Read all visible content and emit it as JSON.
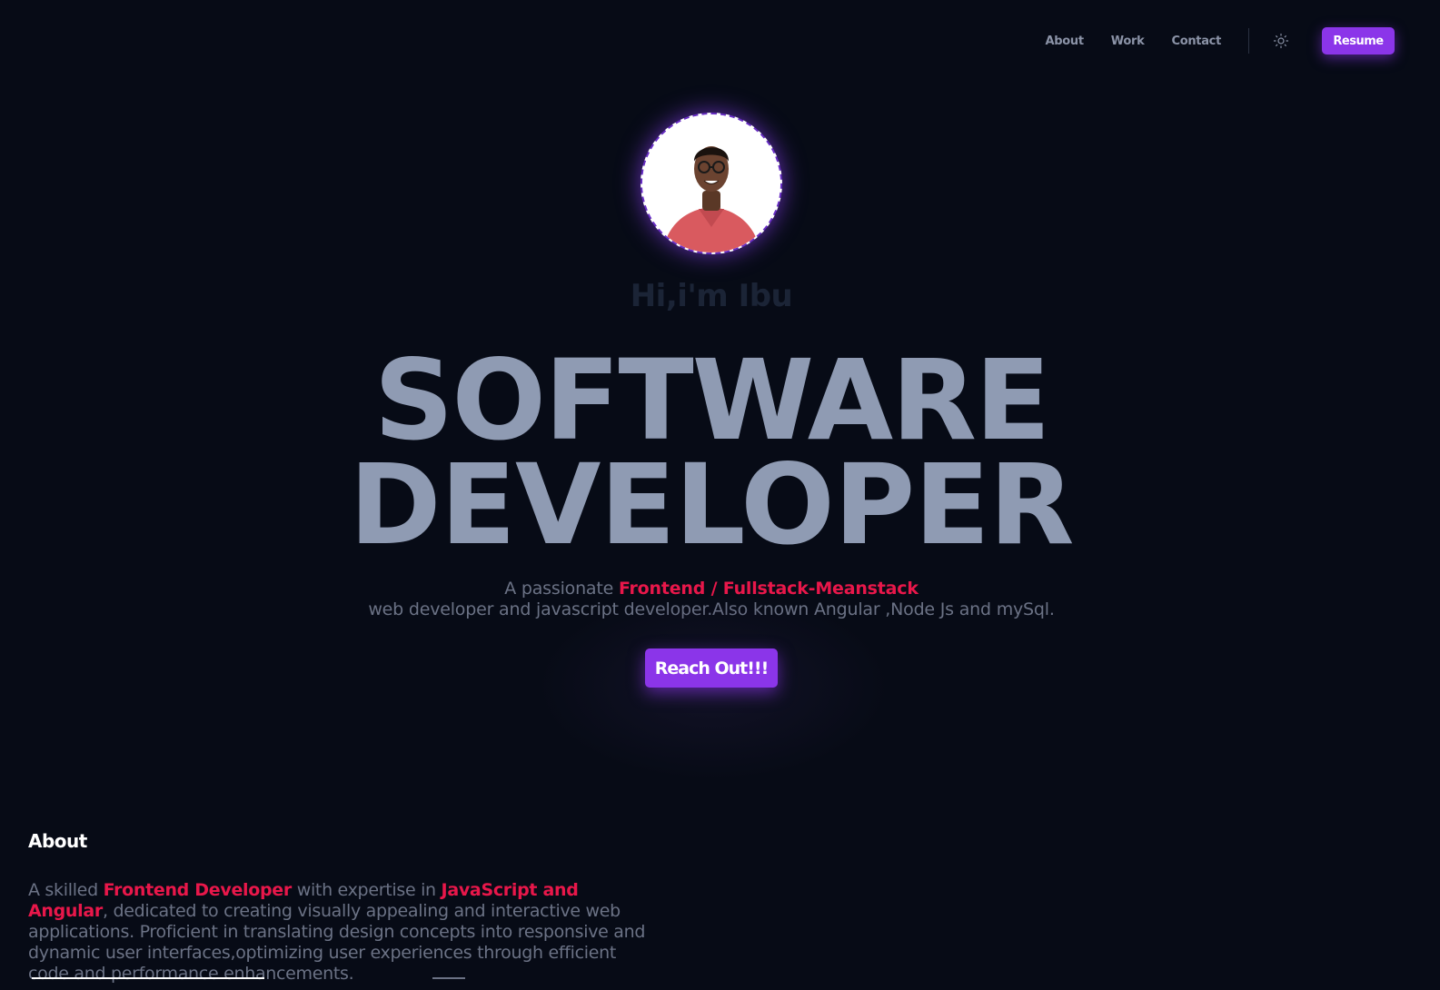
{
  "nav": {
    "links": [
      {
        "label": "About"
      },
      {
        "label": "Work"
      },
      {
        "label": "Contact"
      }
    ],
    "theme_icon": "sun-icon",
    "resume_label": "Resume"
  },
  "hero": {
    "greeting": "Hi,i'm Ibu",
    "headline_line1": "SOFTWARE",
    "headline_line2": "DEVELOPER",
    "tagline": {
      "prefix": "A passionate ",
      "highlight": "Frontend / Fullstack-Meanstack",
      "suffix": " web developer and javascript developer.Also known Angular ,Node Js and mySql."
    },
    "cta_label": "Reach Out!!!"
  },
  "about": {
    "title": "About",
    "text": {
      "part1": "A skilled ",
      "highlight1": "Frontend Developer",
      "part2": " with expertise in ",
      "highlight2": "JavaScript and Angular",
      "part3": ", dedicated to creating visually appealing and interactive web applications. Proficient in translating design concepts into responsive and dynamic user interfaces,optimizing user experiences through efficient code and performance enhancements."
    }
  },
  "colors": {
    "background": "#070b16",
    "accent_purple": "#8b35e9",
    "accent_red": "#e8174a",
    "headline": "#8f9bb3",
    "muted_text": "#6b7285"
  }
}
